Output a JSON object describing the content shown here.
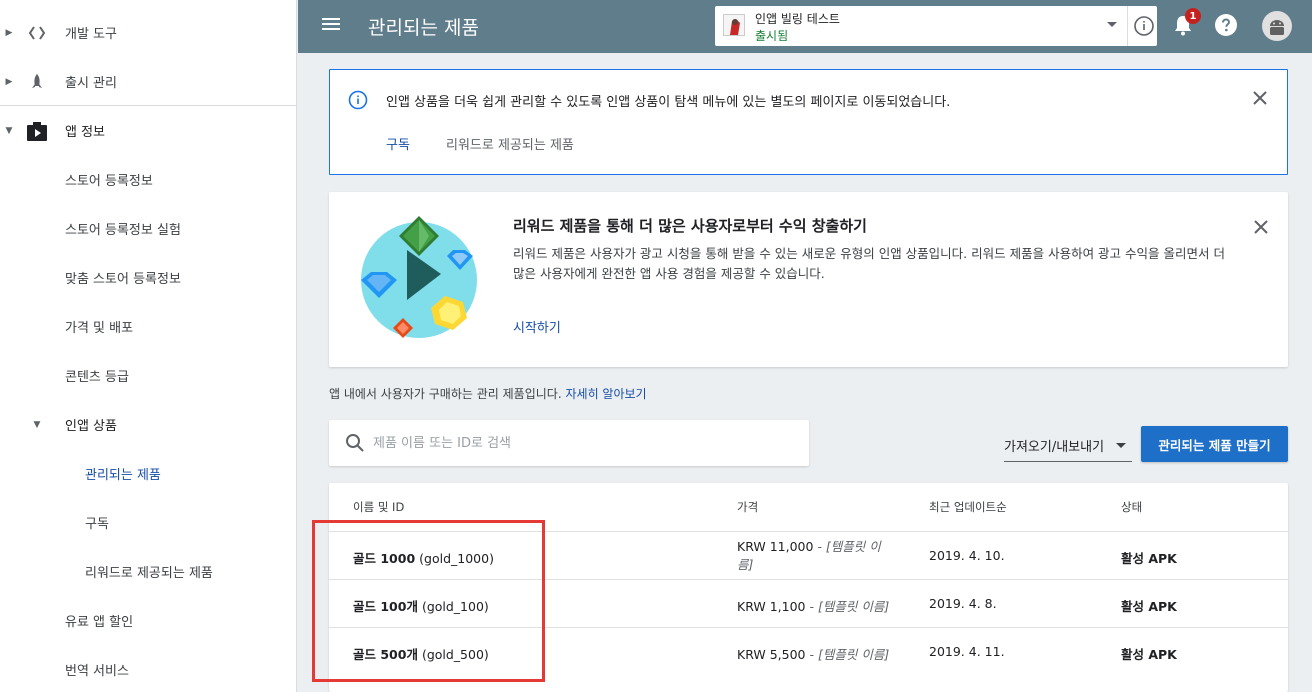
{
  "sidebar": {
    "items": [
      {
        "label": "개발 도구",
        "icon": "code-icon"
      },
      {
        "label": "출시 관리",
        "icon": "rocket-icon"
      },
      {
        "label": "앱 정보",
        "icon": "play-store-icon"
      },
      {
        "label": "스토어 등록정보"
      },
      {
        "label": "스토어 등록정보 실험"
      },
      {
        "label": "맞춤 스토어 등록정보"
      },
      {
        "label": "가격 및 배포"
      },
      {
        "label": "콘텐츠 등급"
      },
      {
        "label": "인앱 상품"
      },
      {
        "label": "관리되는 제품"
      },
      {
        "label": "구독"
      },
      {
        "label": "리워드로 제공되는 제품"
      },
      {
        "label": "유료 앱 할인"
      },
      {
        "label": "번역 서비스"
      }
    ]
  },
  "header": {
    "title": "관리되는 제품",
    "app_name": "인앱 빌링 테스트",
    "app_status": "출시됨",
    "notification_count": "1"
  },
  "info_banner": {
    "text": "인앱 상품을 더욱 쉽게 관리할 수 있도록 인앱 상품이 탐색 메뉴에 있는 별도의 페이지로 이동되었습니다.",
    "link_subscriptions": "구독",
    "link_rewarded": "리워드로 제공되는 제품"
  },
  "promo": {
    "title": "리워드 제품을 통해 더 많은 사용자로부터 수익 창출하기",
    "description": "리워드 제품은 사용자가 광고 시청을 통해 받을 수 있는 새로운 유형의 인앱 상품입니다. 리워드 제품을 사용하여 광고 수익을 올리면서 더 많은 사용자에게 완전한 앱 사용 경험을 제공할 수 있습니다.",
    "cta": "시작하기"
  },
  "description": {
    "text": "앱 내에서 사용자가 구매하는 관리 제품입니다.",
    "link": "자세히 알아보기"
  },
  "search": {
    "placeholder": "제품 이름 또는 ID로 검색"
  },
  "toolbar": {
    "import_export": "가져오기/내보내기",
    "create_button": "관리되는 제품 만들기"
  },
  "table": {
    "headers": [
      "이름 및 ID",
      "가격",
      "최근 업데이트순",
      "상태"
    ],
    "rows": [
      {
        "name": "골드 1000",
        "id": "(gold_1000)",
        "price": "KRW 11,000",
        "price_note": "- [템플릿 이름]",
        "updated": "2019. 4. 10.",
        "status": "활성 APK"
      },
      {
        "name": "골드 100개",
        "id": "(gold_100)",
        "price": "KRW 1,100",
        "price_note": "- [템플릿 이름]",
        "updated": "2019. 4. 8.",
        "status": "활성 APK"
      },
      {
        "name": "골드 500개",
        "id": "(gold_500)",
        "price": "KRW 5,500",
        "price_note": "- [템플릿 이름]",
        "updated": "2019. 4. 11.",
        "status": "활성 APK"
      }
    ]
  },
  "colors": {
    "topbar": "#607d8b",
    "accent": "#1e6fc8",
    "highlight": "#e53935",
    "status_green": "#188038"
  }
}
